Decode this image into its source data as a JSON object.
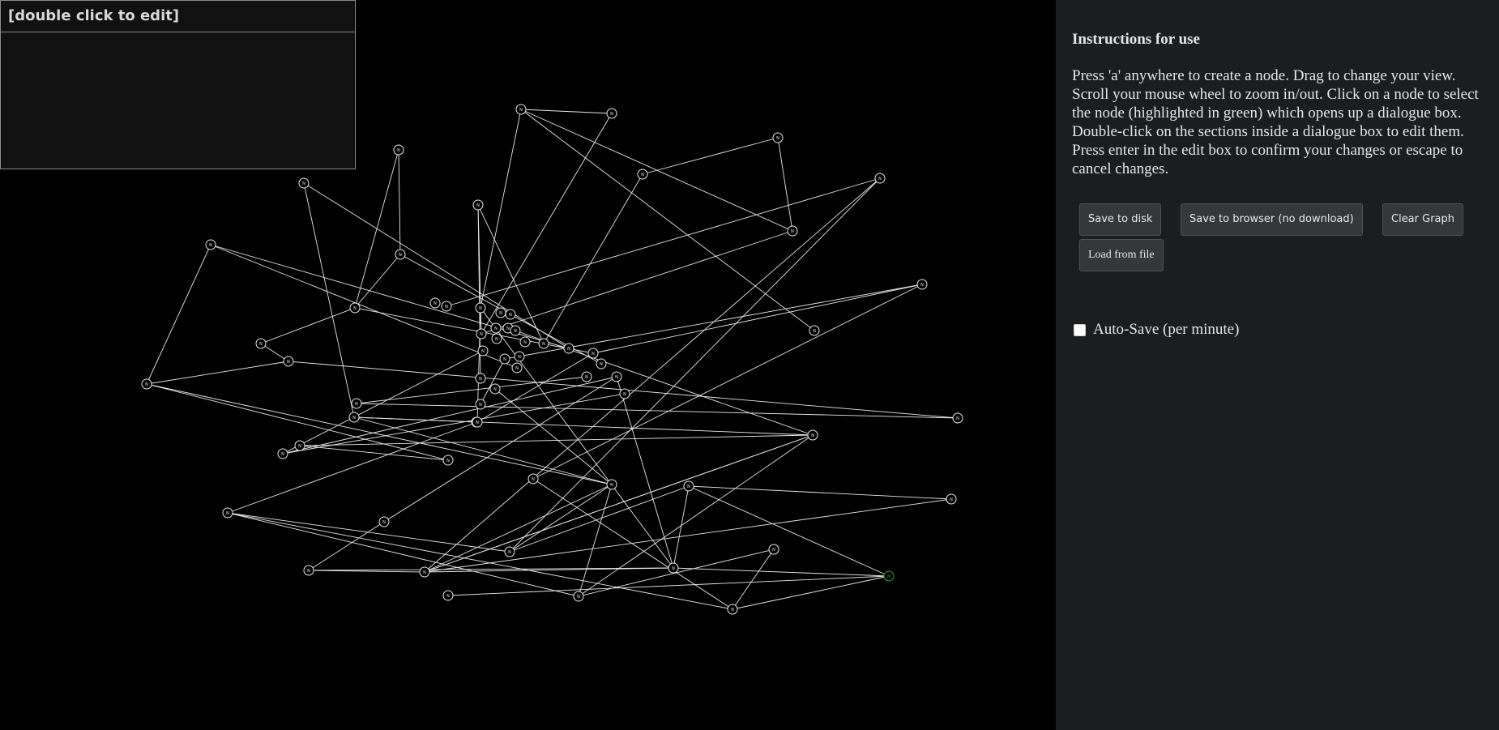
{
  "dialog": {
    "title": "[double click to edit]",
    "body": ""
  },
  "panel": {
    "heading": "Instructions for use",
    "instructions": "Press 'a' anywhere to create a node. Drag to change your view. Scroll your mouse wheel to zoom in/out. Click on a node to select the node (highlighted in green) which opens up a dialogue box. Double-click on the sections inside a dialogue box to edit them. Press enter in the edit box to confirm your changes or escape to cancel changes.",
    "buttons": {
      "save_disk": "Save to disk",
      "save_browser": "Save to browser (no download)",
      "clear": "Clear Graph",
      "load": "Load from file"
    },
    "autosave_label": "Auto-Save (per minute)",
    "autosave_checked": false
  },
  "graph": {
    "colors": {
      "background": "#000000",
      "edge": "#e8e8e8",
      "node_stroke": "#e8e8e8",
      "selected_node": "#2ea043"
    },
    "node_label": "N",
    "selected_node_id": 64
  }
}
